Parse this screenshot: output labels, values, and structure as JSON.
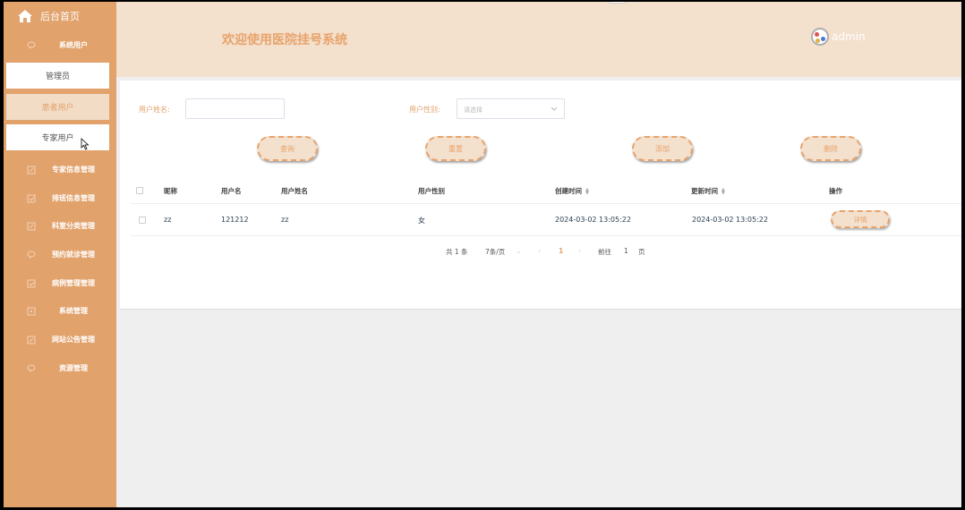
{
  "sidebar": {
    "home": "后台首页",
    "system_users": "系统用户",
    "sub_items": [
      "管理员",
      "患者用户",
      "专家用户"
    ],
    "menu": [
      "专家信息管理",
      "排班信息管理",
      "科室分类管理",
      "预约就诊管理",
      "病例管理管理",
      "系统管理",
      "网站公告管理",
      "资源管理"
    ]
  },
  "header": {
    "title": "欢迎使用医院挂号系统",
    "user": "admin"
  },
  "filters": {
    "name_label": "用户姓名:",
    "name_value": "",
    "gender_label": "用户性别:",
    "gender_placeholder": "请选择"
  },
  "buttons": {
    "query": "查询",
    "reset": "重置",
    "add": "添加",
    "delete": "删除"
  },
  "table": {
    "headers": [
      "昵称",
      "用户名",
      "用户姓名",
      "用户性别",
      "创建时间",
      "更新时间",
      "操作"
    ],
    "rows": [
      {
        "nickname": "zz",
        "username": "121212",
        "realname": "zz",
        "gender": "女",
        "created": "2024-03-02 13:05:22",
        "updated": "2024-03-02 13:05:22",
        "action": "详情"
      }
    ]
  },
  "pagination": {
    "total": "共 1 条",
    "page_size": "7条/页",
    "current": "1",
    "goto_label": "前往",
    "goto_value": "1",
    "page_suffix": "页"
  },
  "colors": {
    "sidebar": "#e2a26c",
    "header": "#f3e0cd",
    "accent": "#e8a36c"
  }
}
